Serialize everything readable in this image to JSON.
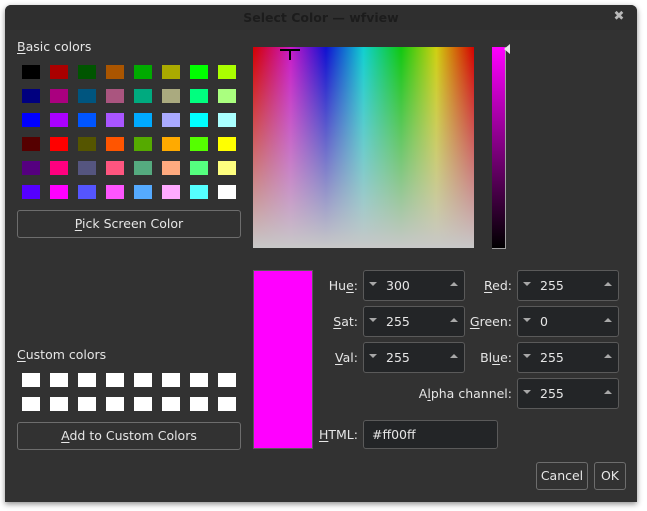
{
  "window": {
    "title": "Select Color — wfview",
    "close_icon": "close-icon"
  },
  "basic_colors": {
    "label_underline": "B",
    "label_rest": "asic colors",
    "swatches": [
      [
        "#000000",
        "#aa0000",
        "#005500",
        "#aa5500",
        "#00aa00",
        "#aaaa00",
        "#00ff00",
        "#aaff00"
      ],
      [
        "#00007f",
        "#aa007f",
        "#00557f",
        "#aa557f",
        "#00aa7f",
        "#aaaa7f",
        "#00ff7f",
        "#aaff7f"
      ],
      [
        "#0000ff",
        "#aa00ff",
        "#0055ff",
        "#aa55ff",
        "#00aaff",
        "#aaaaff",
        "#00ffff",
        "#aaffff"
      ],
      [
        "#550000",
        "#ff0000",
        "#555500",
        "#ff5500",
        "#55aa00",
        "#ffaa00",
        "#55ff00",
        "#ffff00"
      ],
      [
        "#55007f",
        "#ff007f",
        "#55557f",
        "#ff557f",
        "#55aa7f",
        "#ffaa7f",
        "#55ff7f",
        "#ffff7f"
      ],
      [
        "#5500ff",
        "#ff00ff",
        "#5555ff",
        "#ff55ff",
        "#55aaff",
        "#ffaaff",
        "#55ffff",
        "#ffffff"
      ]
    ]
  },
  "pick_screen_button": {
    "underline": "P",
    "rest": "ick Screen Color"
  },
  "custom_colors": {
    "label_underline": "C",
    "label_rest": "ustom colors",
    "swatches": [
      [
        "#ffffff",
        "#ffffff",
        "#ffffff",
        "#ffffff",
        "#ffffff",
        "#ffffff",
        "#ffffff",
        "#ffffff"
      ],
      [
        "#ffffff",
        "#ffffff",
        "#ffffff",
        "#ffffff",
        "#ffffff",
        "#ffffff",
        "#ffffff",
        "#ffffff"
      ]
    ]
  },
  "add_custom_button": {
    "underline": "A",
    "rest": "dd to Custom Colors"
  },
  "current_color": "#ff00ff",
  "fields": {
    "hue": {
      "pre": "Hu",
      "underline": "e",
      "post": ":",
      "value": "300"
    },
    "sat": {
      "pre": "",
      "underline": "S",
      "post": "at:",
      "value": "255"
    },
    "val": {
      "pre": "",
      "underline": "V",
      "post": "al:",
      "value": "255"
    },
    "red": {
      "pre": "",
      "underline": "R",
      "post": "ed:",
      "value": "255"
    },
    "green": {
      "pre": "",
      "underline": "G",
      "post": "reen:",
      "value": "0"
    },
    "blue": {
      "pre": "Bl",
      "underline": "u",
      "post": "e:",
      "value": "255"
    },
    "alpha": {
      "pre": "A",
      "underline": "l",
      "post": "pha channel:",
      "value": "255"
    },
    "html": {
      "pre": "",
      "underline": "H",
      "post": "TML:",
      "value": "#ff00ff"
    }
  },
  "buttons": {
    "cancel": "Cancel",
    "ok": "OK"
  }
}
